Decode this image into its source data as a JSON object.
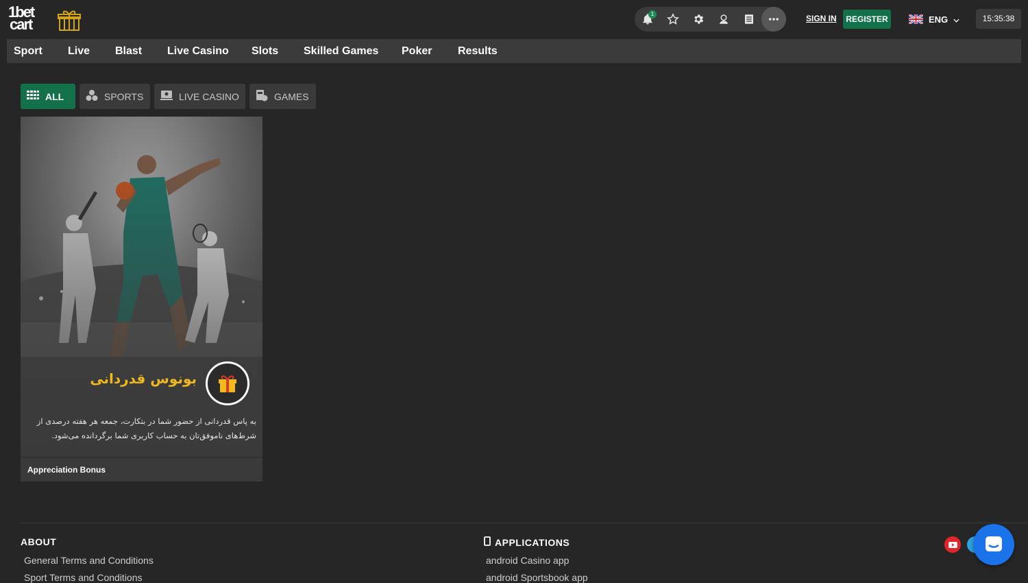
{
  "header": {
    "logo_line1": "1bet",
    "logo_line2": "cart",
    "notification_count": "1",
    "sign_in": "SIGN IN",
    "register": "REGISTER",
    "language": "ENG",
    "time": "15:35:38",
    "icons": [
      "bell-icon",
      "star-icon",
      "gear-icon",
      "user-secret-icon",
      "document-icon",
      "more-icon"
    ]
  },
  "nav": {
    "items": [
      "Sport",
      "Live",
      "Blast",
      "Live Casino",
      "Slots",
      "Skilled Games",
      "Poker",
      "Results"
    ]
  },
  "filters": {
    "items": [
      {
        "label": "ALL",
        "icon": "grid-icon",
        "active": true
      },
      {
        "label": "SPORTS",
        "icon": "balls-icon",
        "active": false
      },
      {
        "label": "LIVE CASINO",
        "icon": "dealer-icon",
        "active": false
      },
      {
        "label": "GAMES",
        "icon": "game-icon",
        "active": false
      }
    ]
  },
  "promo": {
    "title_fa": "بونوس قدردانی",
    "description_fa": "به پاس قدردانی از حضور شما در بتکارت، جمعه هر هفته درصدی از شرط‌های ناموفق‌تان به حساب کاربری شما برگردانده می‌شود.",
    "name": "Appreciation Bonus",
    "accent_color": "#f2b81c"
  },
  "footer": {
    "about_heading": "ABOUT",
    "about_links": [
      "General Terms and Conditions",
      "Sport Terms and Conditions"
    ],
    "apps_heading": "APPLICATIONS",
    "apps_links": [
      "android Casino app",
      "android Sportsbook app"
    ]
  },
  "colors": {
    "background": "#262626",
    "panel": "#3a3a3a",
    "brand_green": "#12714a",
    "chat_blue": "#1a73e8"
  }
}
